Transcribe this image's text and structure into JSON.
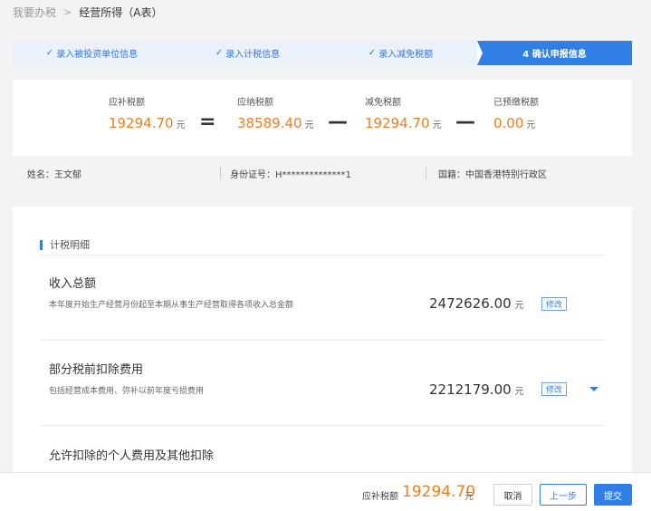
{
  "breadcrumb": {
    "root": "我要办税",
    "separator": ">",
    "current": "经营所得（A表）"
  },
  "steps": [
    {
      "label": "录入被投资单位信息",
      "done": true
    },
    {
      "label": "录入计税信息",
      "done": true
    },
    {
      "label": "录入减免税额",
      "done": true
    },
    {
      "label": "4 确认申报信息",
      "done": false,
      "active": true
    }
  ],
  "summary": {
    "items": [
      {
        "label": "应补税额",
        "value": "19294.70",
        "unit": "元"
      },
      {
        "label": "应纳税额",
        "value": "38589.40",
        "unit": "元"
      },
      {
        "label": "减免税额",
        "value": "19294.70",
        "unit": "元"
      },
      {
        "label": "已预缴税额",
        "value": "0.00",
        "unit": "元"
      }
    ],
    "operators": [
      "=",
      "—",
      "—"
    ]
  },
  "person": {
    "name_label": "姓名：",
    "name": "王文郁",
    "id_label": "身份证号：",
    "id": "H**************1",
    "nationality_label": "国籍：",
    "nationality": "中国香港特别行政区"
  },
  "detail": {
    "title": "计税明细",
    "rows": [
      {
        "title": "收入总额",
        "desc": "本年度开始生产经营月份起至本期从事生产经营取得各项收入总金额",
        "amount": "2472626.00",
        "unit": "元",
        "edit": "修改"
      },
      {
        "title": "部分税前扣除费用",
        "desc": "包括经营成本费用、弥补以前年度亏损费用",
        "amount": "2212179.00",
        "unit": "元",
        "edit": "修改"
      },
      {
        "title": "允许扣除的个人费用及其他扣除"
      }
    ]
  },
  "footer": {
    "label": "应补税额",
    "value": "19294.70",
    "unit": "元",
    "cancel": "取消",
    "prev": "上一步",
    "submit": "提交"
  },
  "colors": {
    "accent": "#2f7fe6",
    "amount": "#f07d1f"
  },
  "icons": {
    "step_done": "check-icon",
    "expand": "caret-down-icon"
  }
}
